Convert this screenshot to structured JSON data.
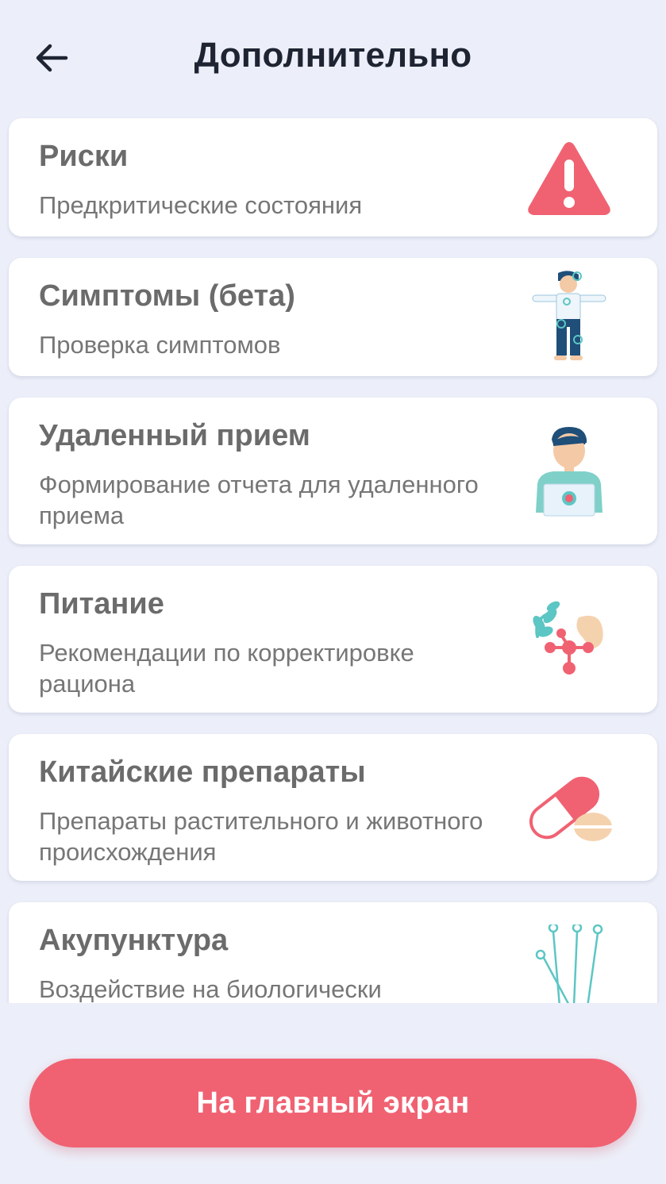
{
  "header": {
    "title": "Дополнительно",
    "back_icon": "arrow-left-icon"
  },
  "items": [
    {
      "title": "Риски",
      "description": "Предкритические состояния",
      "icon": "warning-triangle-icon"
    },
    {
      "title": "Симптомы (бета)",
      "description": "Проверка симптомов",
      "icon": "body-figure-icon"
    },
    {
      "title": "Удаленный прием",
      "description": "Формирование отчета для удаленного приема",
      "icon": "doctor-laptop-icon"
    },
    {
      "title": "Питание",
      "description": "Рекомендации по корректировке рациона",
      "icon": "nutrition-icon"
    },
    {
      "title": "Китайские препараты",
      "description": "Препараты растительного и животного происхождения",
      "icon": "capsule-pill-icon"
    },
    {
      "title": "Акупунктура",
      "description": "Воздействие на биологически",
      "icon": "acupuncture-needles-icon"
    }
  ],
  "footer": {
    "home_button_label": "На главный экран"
  },
  "colors": {
    "background": "#eceff9",
    "accent": "#f06272",
    "card": "#ffffff",
    "teal": "#5cc6c4"
  }
}
